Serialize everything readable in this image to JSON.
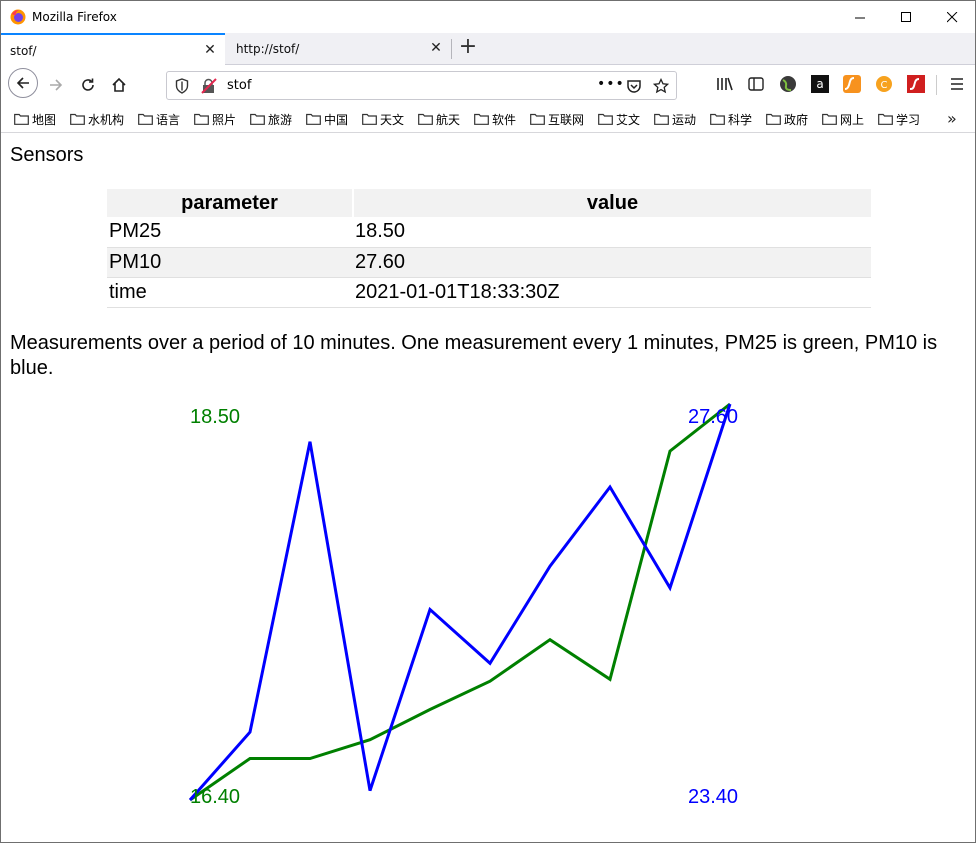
{
  "window": {
    "title": "Mozilla Firefox"
  },
  "tabs": [
    {
      "label": "stof/",
      "active": true
    },
    {
      "label": "http://stof/",
      "active": false
    }
  ],
  "urlbar": {
    "url": "stof",
    "page_actions": "•••"
  },
  "bookmarks": [
    "地图",
    "水机构",
    "语言",
    "照片",
    "旅游",
    "中国",
    "天文",
    "航天",
    "软件",
    "互联网",
    "艾文",
    "运动",
    "科学",
    "政府",
    "网上",
    "学习"
  ],
  "page": {
    "heading": "Sensors",
    "table": {
      "headers": [
        "parameter",
        "value"
      ],
      "rows": [
        [
          "PM25",
          "18.50"
        ],
        [
          "PM10",
          "27.60"
        ],
        [
          "time",
          "2021-01-01T18:33:30Z"
        ]
      ]
    },
    "description": "Measurements over a period of 10 minutes. One measurement every 1 minutes, PM25 is green, PM10 is blue."
  },
  "chart_data": {
    "type": "line",
    "x": [
      0,
      1,
      2,
      3,
      4,
      5,
      6,
      7,
      8,
      9
    ],
    "series": [
      {
        "name": "PM25",
        "color": "#008000",
        "values": [
          16.4,
          16.62,
          16.62,
          16.72,
          16.88,
          17.03,
          17.25,
          17.04,
          18.25,
          18.5
        ],
        "min_label": "16.40",
        "max_label": "18.50"
      },
      {
        "name": "PM10",
        "color": "#0000ff",
        "values": [
          23.4,
          24.12,
          27.2,
          23.5,
          25.42,
          24.85,
          25.88,
          26.72,
          25.65,
          27.6
        ],
        "min_label": "23.40",
        "max_label": "27.60"
      }
    ],
    "colors": {
      "pm25": "#008000",
      "pm10": "#0000ff"
    }
  }
}
